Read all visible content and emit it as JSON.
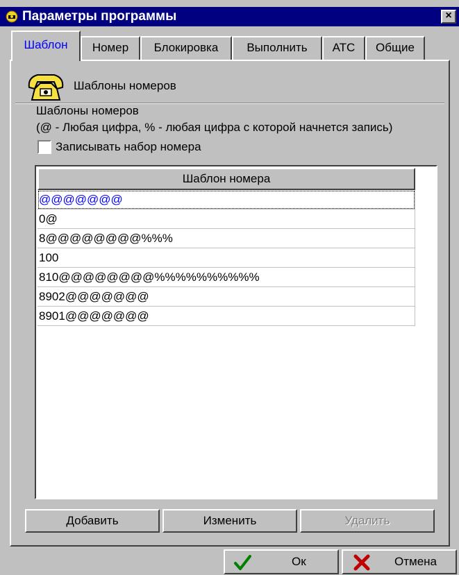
{
  "window": {
    "title": "Параметры программы",
    "close_symbol": "×",
    "title_icon": "app-icon",
    "colors": {
      "titlebar": "#000080",
      "face": "#c0c0c0",
      "active_tab": "#0000ff"
    }
  },
  "tabs": [
    {
      "label": "Шаблон",
      "active": true
    },
    {
      "label": "Номер"
    },
    {
      "label": "Блокировка"
    },
    {
      "label": "Выполнить"
    },
    {
      "label": "АТС"
    },
    {
      "label": "Общие"
    }
  ],
  "panel": {
    "header_icon": "telephone-icon",
    "header_text": "Шаблоны номеров",
    "section_title": "Шаблоны номеров",
    "section_hint": "(@ - Любая цифра, % - любая цифра с которой начнется запись)",
    "checkbox_label": "Записывать набор номера",
    "checkbox_checked": false
  },
  "grid": {
    "column_header": "Шаблон номера",
    "rows": [
      "@@@@@@@",
      "0@",
      "8@@@@@@@@%%%",
      "100",
      "810@@@@@@@@%%%%%%%%%%",
      "8902@@@@@@@",
      "8901@@@@@@@"
    ],
    "selected_index": 0
  },
  "buttons": {
    "add": "Добавить",
    "edit": "Изменить",
    "delete": "Удалить",
    "ok": "Ок",
    "cancel": "Отмена"
  }
}
